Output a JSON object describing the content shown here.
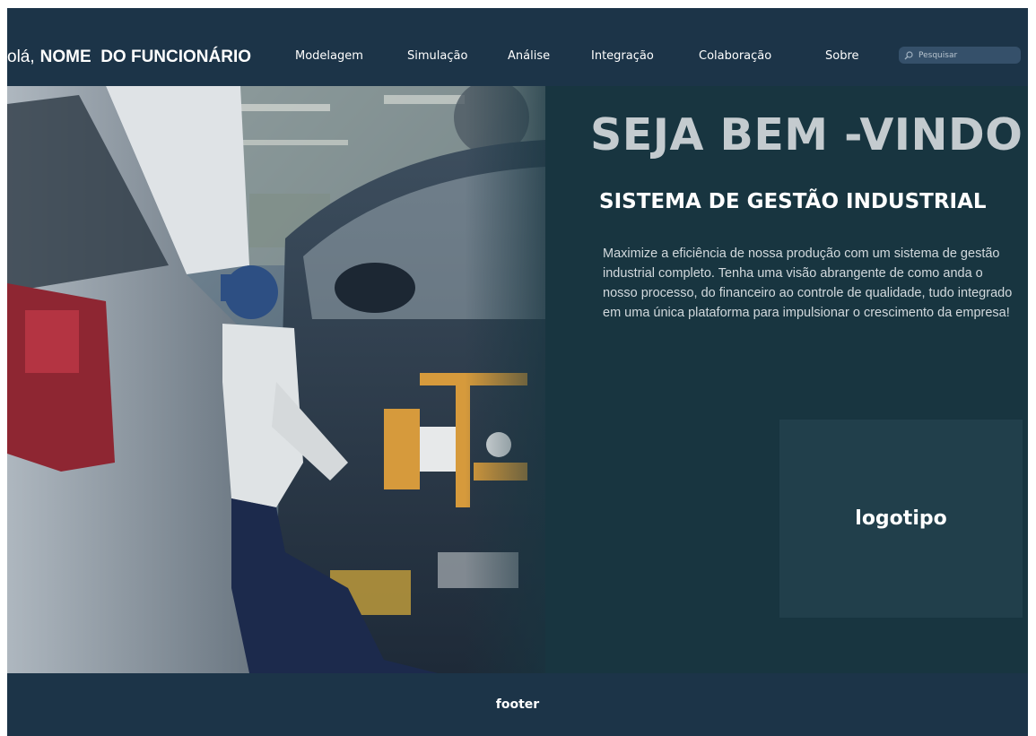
{
  "header": {
    "greeting_prefix": "olá,",
    "user_name": "NOME  DO FUNCIONÁRIO",
    "nav": [
      {
        "label": "Modelagem"
      },
      {
        "label": "Simulação"
      },
      {
        "label": "Análise"
      },
      {
        "label": "Integração"
      },
      {
        "label": "Colaboração"
      },
      {
        "label": "Sobre"
      }
    ],
    "search": {
      "placeholder": "Pesquisar",
      "icon": "search-icon"
    }
  },
  "hero": {
    "welcome": "SEJA BEM -VINDO",
    "subtitle": "SISTEMA DE GESTÃO INDUSTRIAL",
    "description": "Maximize a eficiência de nossa produção com um sistema de gestão industrial completo. Tenha uma visão abrangente de como anda o nosso processo, do financeiro ao controle de qualidade, tudo integrado em uma única plataforma para impulsionar o crescimento da empresa!",
    "logo_label": "logotipo"
  },
  "footer": {
    "label": "footer"
  },
  "colors": {
    "header_bg": "#1c3448",
    "hero_bg": "#183540",
    "logo_box_bg": "#213f4b",
    "welcome_text": "#c4cbcf"
  }
}
